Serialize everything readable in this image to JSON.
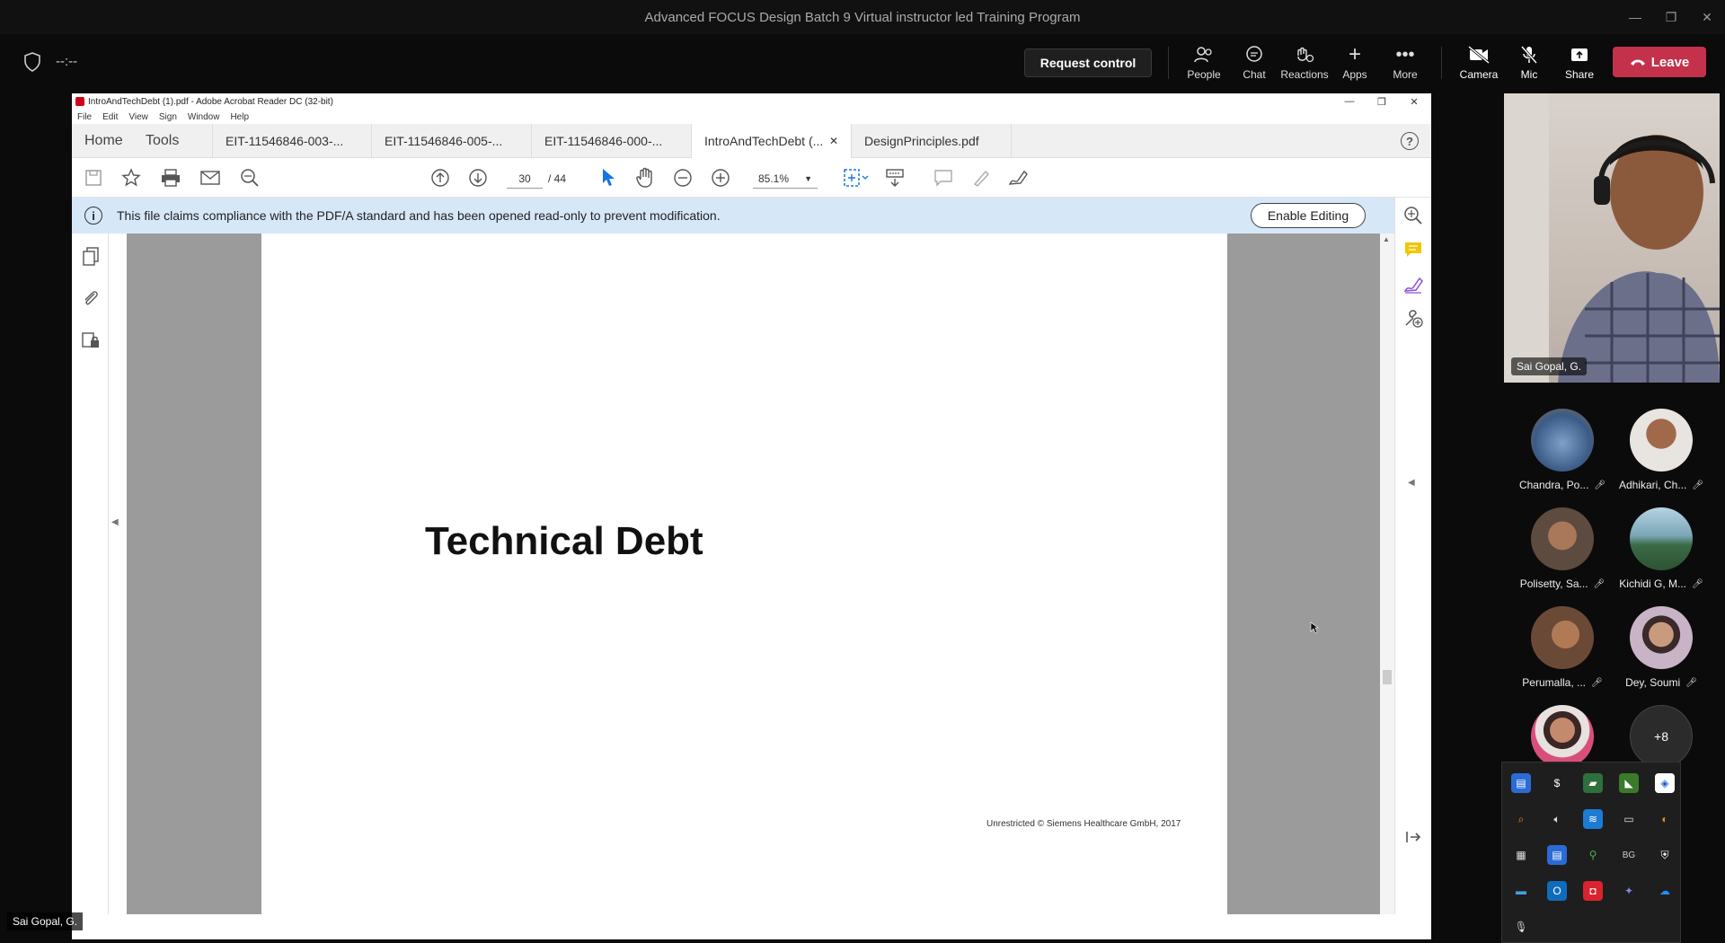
{
  "teams": {
    "window_title": "Advanced FOCUS Design Batch 9 Virtual instructor led Training Program",
    "timer": "--:--",
    "request_control": "Request control",
    "buttons": {
      "people": "People",
      "chat": "Chat",
      "reactions": "Reactions",
      "apps": "Apps",
      "more": "More",
      "camera": "Camera",
      "mic": "Mic",
      "share": "Share",
      "leave": "Leave"
    },
    "self_name": "Sai Gopal, G.",
    "participants": [
      {
        "name": "Chandra, Po...",
        "color": "#5a7aa8"
      },
      {
        "name": "Adhikari, Ch...",
        "color": "#e8e4e0"
      },
      {
        "name": "Polisetty, Sa...",
        "color": "#5e4b3f"
      },
      {
        "name": "Kichidi G, M...",
        "color": "#4f7f8a"
      },
      {
        "name": "Perumalla, ...",
        "color": "#6a4a36"
      },
      {
        "name": "Dey, Soumi",
        "color": "#c9b3c7"
      }
    ],
    "more_count": "+8",
    "bottom_name": "Sai Gopal, G."
  },
  "acrobat": {
    "title": "IntroAndTechDebt (1).pdf - Adobe Acrobat Reader DC (32-bit)",
    "menu": [
      "File",
      "Edit",
      "View",
      "Sign",
      "Window",
      "Help"
    ],
    "home": "Home",
    "tools": "Tools",
    "tabs": [
      "EIT-11546846-003-...",
      "EIT-11546846-005-...",
      "EIT-11546846-000-...",
      "IntroAndTechDebt (...",
      "DesignPrinciples.pdf"
    ],
    "active_tab_index": 3,
    "page_current": "30",
    "page_total": "/  44",
    "zoom": "85.1%",
    "info_message": "This file claims compliance with the PDF/A standard and has been opened read-only to prevent modification.",
    "enable_editing": "Enable Editing",
    "slide_title": "Technical Debt",
    "slide_footer": "Unrestricted © Siemens Healthcare GmbH, 2017"
  }
}
